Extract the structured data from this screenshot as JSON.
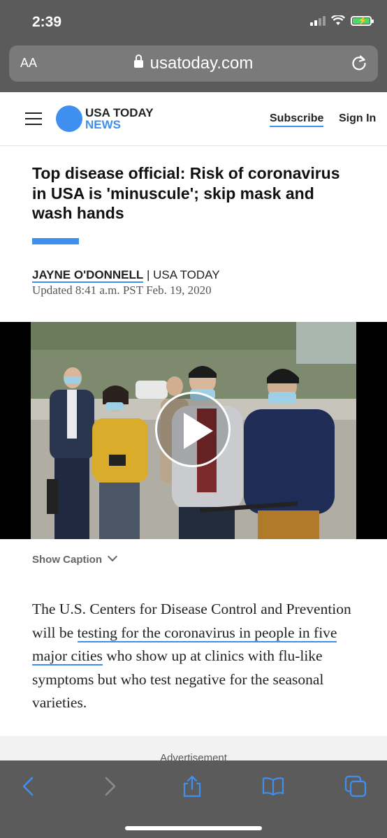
{
  "status_bar": {
    "time": "2:39"
  },
  "browser": {
    "text_size_label": "AA",
    "url": "usatoday.com"
  },
  "site": {
    "logo_line1": "USA TODAY",
    "logo_line2": "NEWS",
    "subscribe_label": "Subscribe",
    "signin_label": "Sign In",
    "accent_color": "#3f8ff0"
  },
  "article": {
    "headline": "Top disease official: Risk of coronavirus in USA is 'minuscule'; skip mask and wash hands",
    "author": "JAYNE O'DONNELL",
    "byline_separator": " | ",
    "outlet": "USA TODAY",
    "updated": "Updated 8:41 a.m. PST Feb. 19, 2020",
    "show_caption_label": "Show Caption",
    "body_before_link": "The U.S. Centers for Disease Control and Prevention will be ",
    "body_link": "testing for the coronavirus in people in five major cities",
    "body_after_link": " who show up at clinics with flu-like symptoms but who test negative for the seasonal varieties.",
    "advertisement_label": "Advertisement"
  },
  "icons": {
    "lock": "lock-icon",
    "reload": "reload-icon",
    "menu": "hamburger-menu-icon",
    "play": "play-icon",
    "back": "back-arrow-icon",
    "forward": "forward-arrow-icon",
    "share": "share-icon",
    "bookmarks": "book-icon",
    "tabs": "tabs-icon"
  }
}
